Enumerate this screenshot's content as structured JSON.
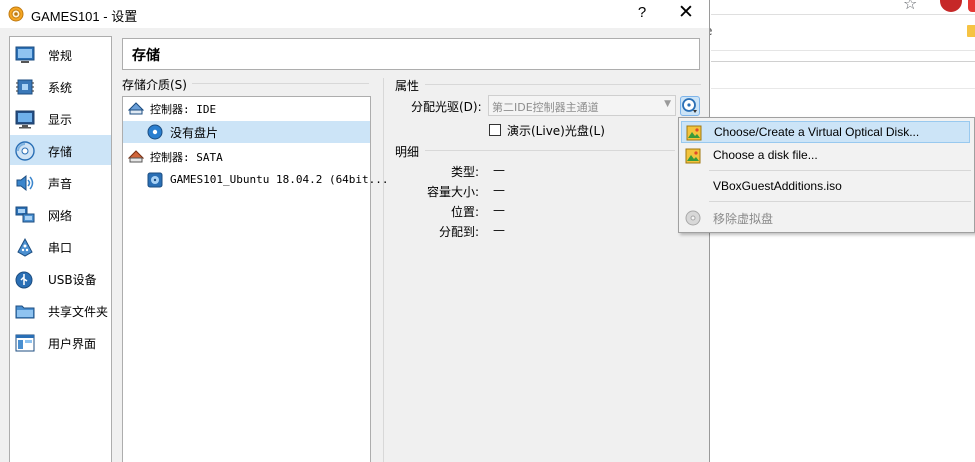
{
  "window": {
    "title": "GAMES101 - 设置",
    "help_glyph": "?",
    "close_glyph": "✕",
    "icon": "gear-icon"
  },
  "background_browser": {
    "partial_text": "e"
  },
  "sidebar": {
    "items": [
      {
        "label": "常规",
        "icon": "general-icon"
      },
      {
        "label": "系统",
        "icon": "system-chip-icon"
      },
      {
        "label": "显示",
        "icon": "monitor-icon"
      },
      {
        "label": "存储",
        "icon": "storage-disk-icon",
        "selected": true
      },
      {
        "label": "声音",
        "icon": "speaker-icon"
      },
      {
        "label": "网络",
        "icon": "network-icon"
      },
      {
        "label": "串口",
        "icon": "serial-port-icon"
      },
      {
        "label": "USB设备",
        "icon": "usb-icon"
      },
      {
        "label": "共享文件夹",
        "icon": "shared-folder-icon"
      },
      {
        "label": "用户界面",
        "icon": "user-interface-icon"
      }
    ]
  },
  "section": {
    "title": "存储"
  },
  "storage": {
    "group_label": "存储介质(S)",
    "tree": [
      {
        "text": "控制器: IDE",
        "icon": "ide-controller-icon",
        "level": 0
      },
      {
        "text": "没有盘片",
        "icon": "empty-optical-disk-icon",
        "level": 1,
        "selected": true
      },
      {
        "text": "控制器: SATA",
        "icon": "sata-controller-icon",
        "level": 0
      },
      {
        "text": "GAMES101_Ubuntu 18.04.2 (64bit...",
        "icon": "hard-disk-icon",
        "level": 1
      }
    ]
  },
  "properties": {
    "group_label": "属性",
    "drive_label": "分配光驱(D):",
    "drive_value": "第二IDE控制器主通道",
    "live_cd_label": "演示(Live)光盘(L)",
    "live_cd_checked": false
  },
  "details": {
    "group_label": "明细",
    "rows": [
      {
        "key": "类型:",
        "value": "—"
      },
      {
        "key": "容量大小:",
        "value": "—"
      },
      {
        "key": "位置:",
        "value": "—"
      },
      {
        "key": "分配到:",
        "value": "—"
      }
    ]
  },
  "disk_menu": {
    "items": [
      {
        "label": "Choose/Create a Virtual Optical Disk...",
        "icon": "choose-disk-icon",
        "highlighted": true,
        "enabled": true
      },
      {
        "label": "Choose a disk file...",
        "icon": "disk-file-icon",
        "enabled": true
      },
      {
        "label": "VBoxGuestAdditions.iso",
        "icon": "",
        "enabled": true
      },
      {
        "label": "移除虚拟盘",
        "icon": "remove-disk-icon",
        "enabled": false
      }
    ]
  },
  "colors": {
    "selection": "#cce4f7",
    "dialog_bg": "#f0f0f0",
    "accent_blue": "#1e78c8"
  }
}
